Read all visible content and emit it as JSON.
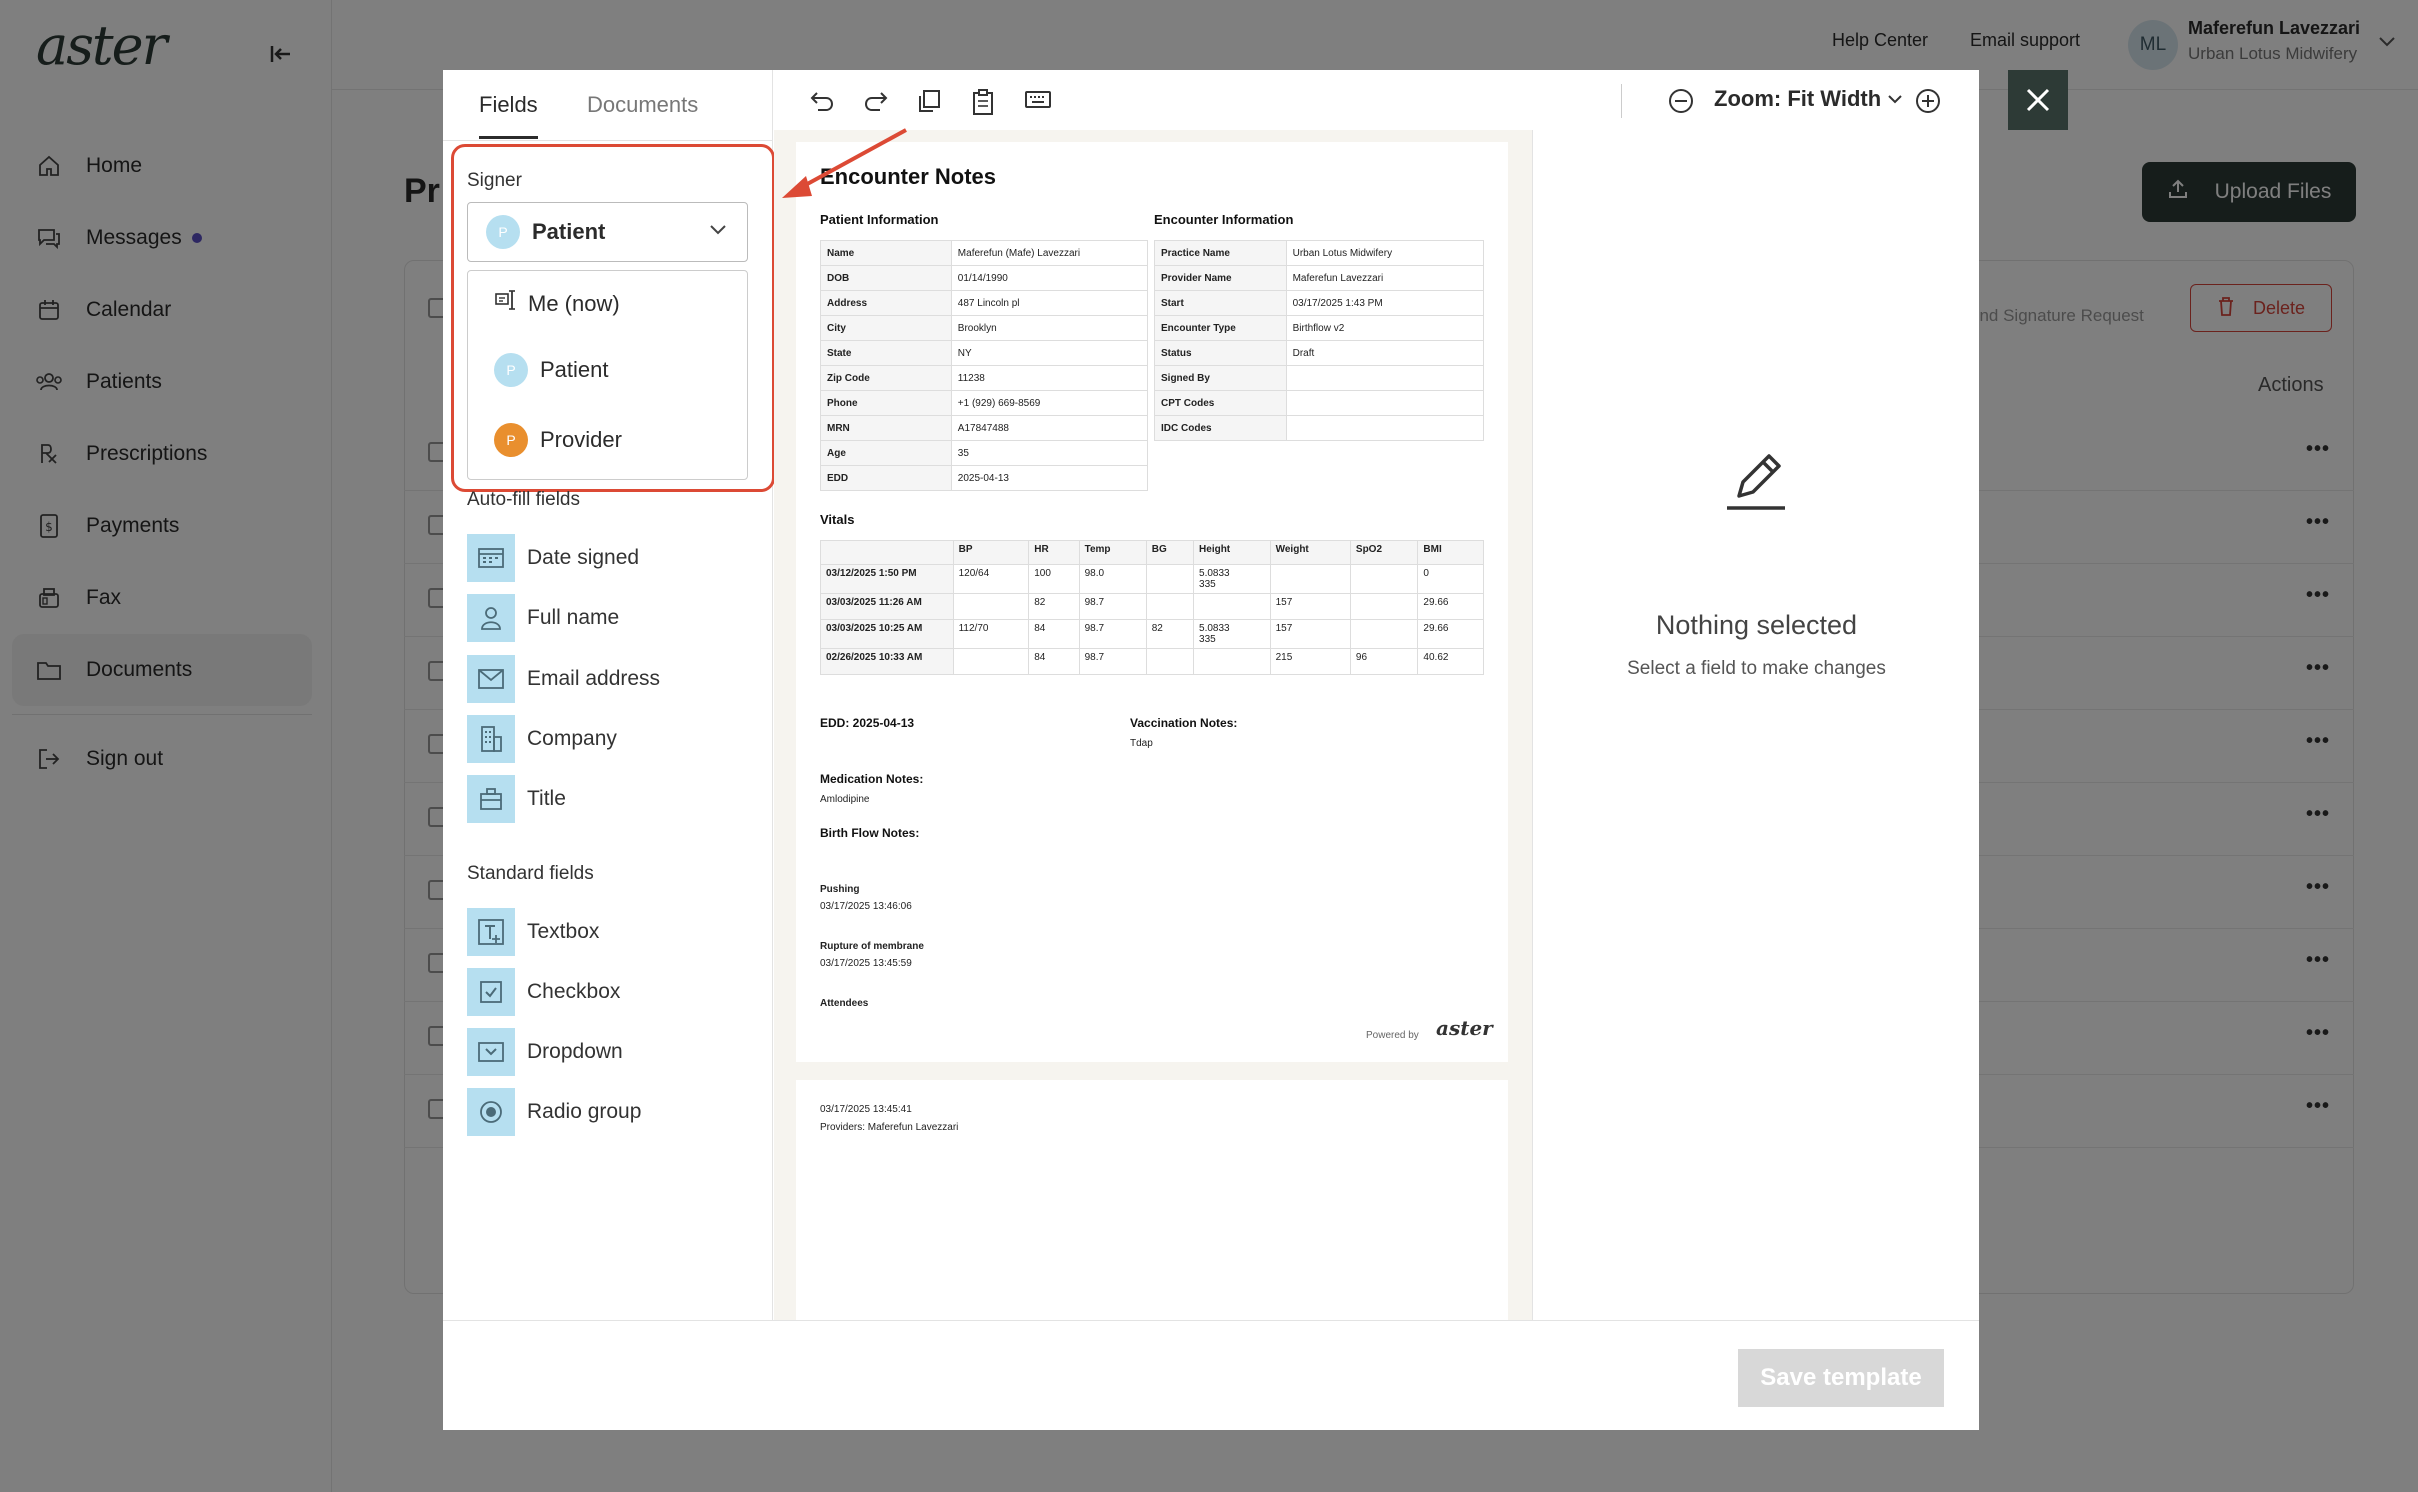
{
  "app": {
    "logo": "aster",
    "nav": [
      {
        "label": "Home",
        "icon": "home-icon"
      },
      {
        "label": "Messages",
        "icon": "messages-icon",
        "badge": "unread-dot"
      },
      {
        "label": "Calendar",
        "icon": "calendar-icon"
      },
      {
        "label": "Patients",
        "icon": "patients-icon"
      },
      {
        "label": "Prescriptions",
        "icon": "prescription-icon"
      },
      {
        "label": "Payments",
        "icon": "payments-icon"
      },
      {
        "label": "Fax",
        "icon": "fax-icon"
      },
      {
        "label": "Documents",
        "icon": "folder-icon",
        "active": true
      }
    ],
    "sign_out": "Sign out",
    "topbar": {
      "help": "Help Center",
      "email": "Email support",
      "initials": "ML",
      "user_name": "Maferefun Lavezzari",
      "user_org": "Urban Lotus Midwifery"
    },
    "page_title": "Pr",
    "upload": "Upload Files",
    "send_request": "end Signature Request",
    "delete": "Delete",
    "actions": "Actions"
  },
  "modal": {
    "tabs": [
      "Fields",
      "Documents"
    ],
    "signer_label": "Signer",
    "signer_selected": {
      "initial": "P",
      "label": "Patient"
    },
    "signer_options": [
      {
        "label": "Me (now)",
        "icon": "signature-pen-icon"
      },
      {
        "initial": "P",
        "label": "Patient",
        "color": "#b6dff0"
      },
      {
        "initial": "P",
        "label": "Provider",
        "color": "#e98f2e"
      }
    ],
    "autofill_label": "Auto-fill fields",
    "autofill": [
      {
        "label": "Date signed",
        "icon": "calendar-field-icon"
      },
      {
        "label": "Full name",
        "icon": "person-icon"
      },
      {
        "label": "Email address",
        "icon": "envelope-icon"
      },
      {
        "label": "Company",
        "icon": "building-icon"
      },
      {
        "label": "Title",
        "icon": "briefcase-icon"
      }
    ],
    "standard_label": "Standard fields",
    "standard": [
      {
        "label": "Textbox",
        "icon": "textbox-icon"
      },
      {
        "label": "Checkbox",
        "icon": "checkbox-icon"
      },
      {
        "label": "Dropdown",
        "icon": "dropdown-icon"
      },
      {
        "label": "Radio group",
        "icon": "radio-icon"
      }
    ],
    "zoom": "Zoom: Fit Width",
    "nothing_selected": "Nothing selected",
    "nothing_hint": "Select a field to make changes",
    "save": "Save template"
  },
  "document": {
    "title": "Encounter Notes",
    "patient_heading": "Patient Information",
    "encounter_heading": "Encounter Information",
    "patient_info": [
      [
        "Name",
        "Maferefun (Mafe) Lavezzari"
      ],
      [
        "DOB",
        "01/14/1990"
      ],
      [
        "Address",
        "487 Lincoln pl"
      ],
      [
        "City",
        "Brooklyn"
      ],
      [
        "State",
        "NY"
      ],
      [
        "Zip Code",
        "11238"
      ],
      [
        "Phone",
        "+1 (929) 669-8569"
      ],
      [
        "MRN",
        "A17847488"
      ],
      [
        "Age",
        "35"
      ],
      [
        "EDD",
        "2025-04-13"
      ]
    ],
    "encounter_info": [
      [
        "Practice Name",
        "Urban Lotus Midwifery"
      ],
      [
        "Provider Name",
        "Maferefun Lavezzari"
      ],
      [
        "Start",
        "03/17/2025 1:43 PM"
      ],
      [
        "Encounter Type",
        "Birthflow v2"
      ],
      [
        "Status",
        "Draft"
      ],
      [
        "Signed By",
        ""
      ],
      [
        "CPT Codes",
        ""
      ],
      [
        "IDC Codes",
        ""
      ]
    ],
    "vitals_heading": "Vitals",
    "vitals_cols": [
      "",
      "BP",
      "HR",
      "Temp",
      "BG",
      "Height",
      "Weight",
      "SpO2",
      "BMI"
    ],
    "vitals_rows": [
      [
        "03/12/2025 1:50 PM",
        "120/64",
        "100",
        "98.0",
        "",
        "5.0833\n335",
        "",
        "",
        "0"
      ],
      [
        "03/03/2025 11:26 AM",
        "",
        "82",
        "98.7",
        "",
        "",
        "157",
        "",
        "29.66"
      ],
      [
        "03/03/2025 10:25 AM",
        "112/70",
        "84",
        "98.7",
        "82",
        "5.0833\n335",
        "157",
        "",
        "29.66"
      ],
      [
        "02/26/2025 10:33 AM",
        "",
        "84",
        "98.7",
        "",
        "",
        "215",
        "96",
        "40.62"
      ]
    ],
    "edd_line": "EDD: 2025-04-13",
    "vacc_heading": "Vaccination Notes:",
    "vacc_value": "Tdap",
    "med_heading": "Medication Notes:",
    "med_value": "Amlodipine",
    "birth_heading": "Birth Flow Notes:",
    "pushing_label": "Pushing",
    "pushing_time": "03/17/2025 13:46:06",
    "rupture_label": "Rupture of membrane",
    "rupture_time": "03/17/2025 13:45:59",
    "attendees": "Attendees",
    "powered_by": "Powered by",
    "powered_logo": "aster",
    "page2_time": "03/17/2025 13:45:41",
    "page2_providers": "Providers: Maferefun Lavezzari"
  },
  "colors": {
    "accent_dark": "#2d3a36",
    "field_icon_bg": "#b6dff0",
    "highlight": "#dc4a35",
    "delete": "#d6453b"
  }
}
